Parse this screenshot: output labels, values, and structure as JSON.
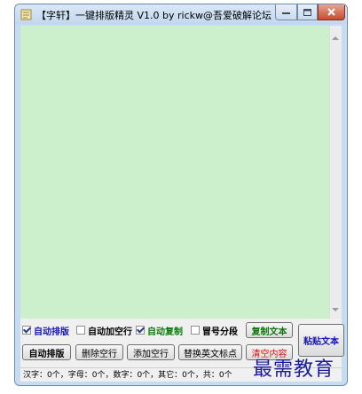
{
  "window": {
    "title": "【字轩】一键排版精灵 V1.0 by rickw@吾爱破解论坛",
    "icons": {
      "app": "note-icon",
      "minimize": "minimize-icon",
      "maximize": "maximize-icon",
      "close": "close-icon"
    },
    "colors": {
      "editor_bg": "#ccf0cc",
      "close_btn": "#c94b30"
    }
  },
  "options": [
    {
      "label": "自动排版",
      "checked": true
    },
    {
      "label": "自动加空行",
      "checked": false
    },
    {
      "label": "自动复制",
      "checked": true
    },
    {
      "label": "冒号分段",
      "checked": false
    }
  ],
  "buttons": {
    "copy": "复制文本",
    "paste": "粘贴文本",
    "format": "自动排版",
    "delete_blank": "删除空行",
    "add_blank": "添加空行",
    "replace_punct": "替换英文标点",
    "clear": "清空内容"
  },
  "status": {
    "text": "汉字：0个，字母：0个，数字：0个，其它：0个，共：0个"
  },
  "watermark": {
    "text": "最需教育"
  }
}
